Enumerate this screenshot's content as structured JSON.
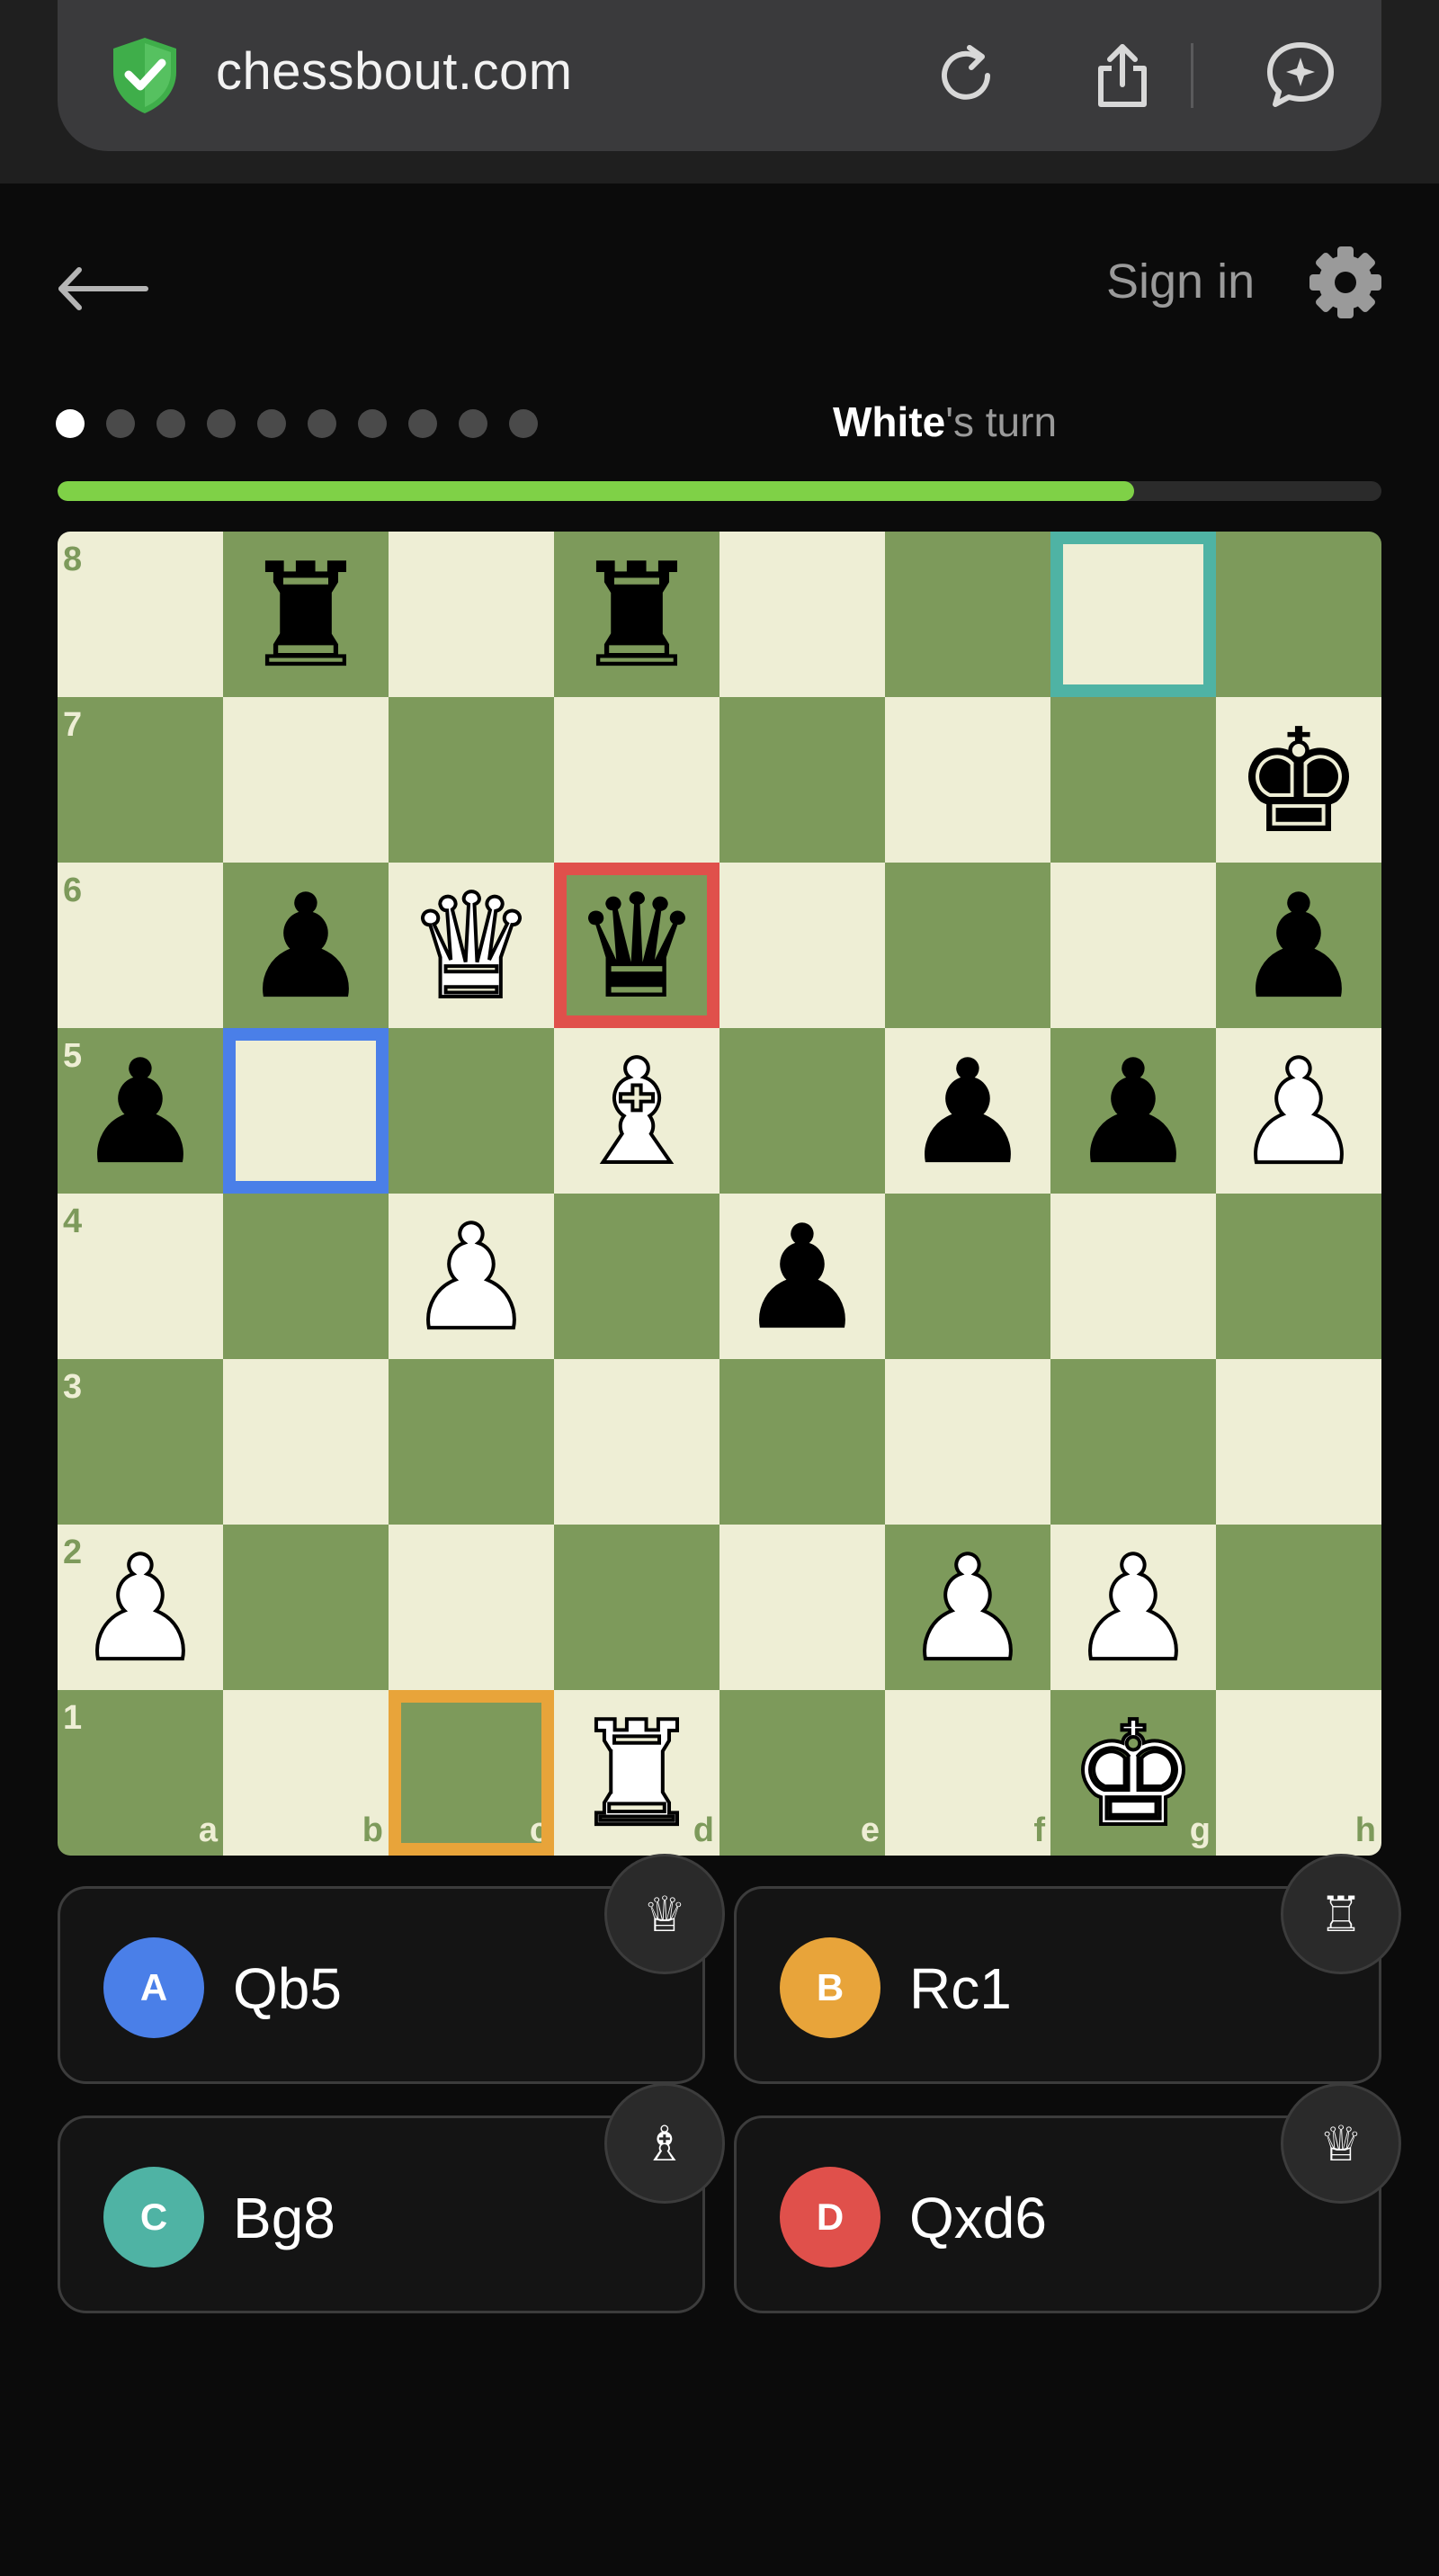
{
  "browser": {
    "url": "chessbout.com",
    "icons": [
      "shield-check-icon",
      "reload-icon",
      "share-icon",
      "assistant-chat-icon"
    ]
  },
  "header": {
    "back_icon": "back-arrow-icon",
    "sign_in": "Sign in",
    "settings_icon": "gear-icon"
  },
  "progress": {
    "dots_total": 10,
    "dots_active_index": 0,
    "turn_player": "White",
    "turn_suffix": "'s turn",
    "fill_fraction": 0.813
  },
  "board": {
    "orientation": "white",
    "light_color": "#eeeed5",
    "dark_color": "#7d9a5b",
    "ranks": [
      "8",
      "7",
      "6",
      "5",
      "4",
      "3",
      "2",
      "1"
    ],
    "files": [
      "a",
      "b",
      "c",
      "d",
      "e",
      "f",
      "g",
      "h"
    ],
    "pieces": [
      {
        "square": "b8",
        "type": "rook",
        "color": "black"
      },
      {
        "square": "d8",
        "type": "rook",
        "color": "black"
      },
      {
        "square": "h7",
        "type": "king",
        "color": "black"
      },
      {
        "square": "b6",
        "type": "pawn",
        "color": "black"
      },
      {
        "square": "c6",
        "type": "queen",
        "color": "white"
      },
      {
        "square": "d6",
        "type": "queen",
        "color": "black"
      },
      {
        "square": "h6",
        "type": "pawn",
        "color": "black"
      },
      {
        "square": "a5",
        "type": "pawn",
        "color": "black"
      },
      {
        "square": "d5",
        "type": "bishop",
        "color": "white"
      },
      {
        "square": "f5",
        "type": "pawn",
        "color": "black"
      },
      {
        "square": "g5",
        "type": "pawn",
        "color": "black"
      },
      {
        "square": "h5",
        "type": "pawn",
        "color": "white"
      },
      {
        "square": "c4",
        "type": "pawn",
        "color": "white"
      },
      {
        "square": "e4",
        "type": "pawn",
        "color": "black"
      },
      {
        "square": "a2",
        "type": "pawn",
        "color": "white"
      },
      {
        "square": "f2",
        "type": "pawn",
        "color": "white"
      },
      {
        "square": "g2",
        "type": "pawn",
        "color": "white"
      },
      {
        "square": "d1",
        "type": "rook",
        "color": "white"
      },
      {
        "square": "g1",
        "type": "king",
        "color": "white"
      }
    ],
    "highlights": [
      {
        "square": "g8",
        "color": "#4fb3a4"
      },
      {
        "square": "d6",
        "color": "#e0504b"
      },
      {
        "square": "b5",
        "color": "#4a7fe8"
      },
      {
        "square": "c1",
        "color": "#e8a43a"
      }
    ]
  },
  "options": [
    {
      "letter": "A",
      "move": "Qb5",
      "color": "#4a7fe8",
      "piece_icon": "white-queen-icon",
      "piece_glyph": "♕"
    },
    {
      "letter": "B",
      "move": "Rc1",
      "color": "#e8a43a",
      "piece_icon": "white-rook-icon",
      "piece_glyph": "♖"
    },
    {
      "letter": "C",
      "move": "Bg8",
      "color": "#4fb3a4",
      "piece_icon": "white-bishop-icon",
      "piece_glyph": "♗"
    },
    {
      "letter": "D",
      "move": "Qxd6",
      "color": "#e0504b",
      "piece_icon": "white-queen-icon",
      "piece_glyph": "♕"
    }
  ]
}
